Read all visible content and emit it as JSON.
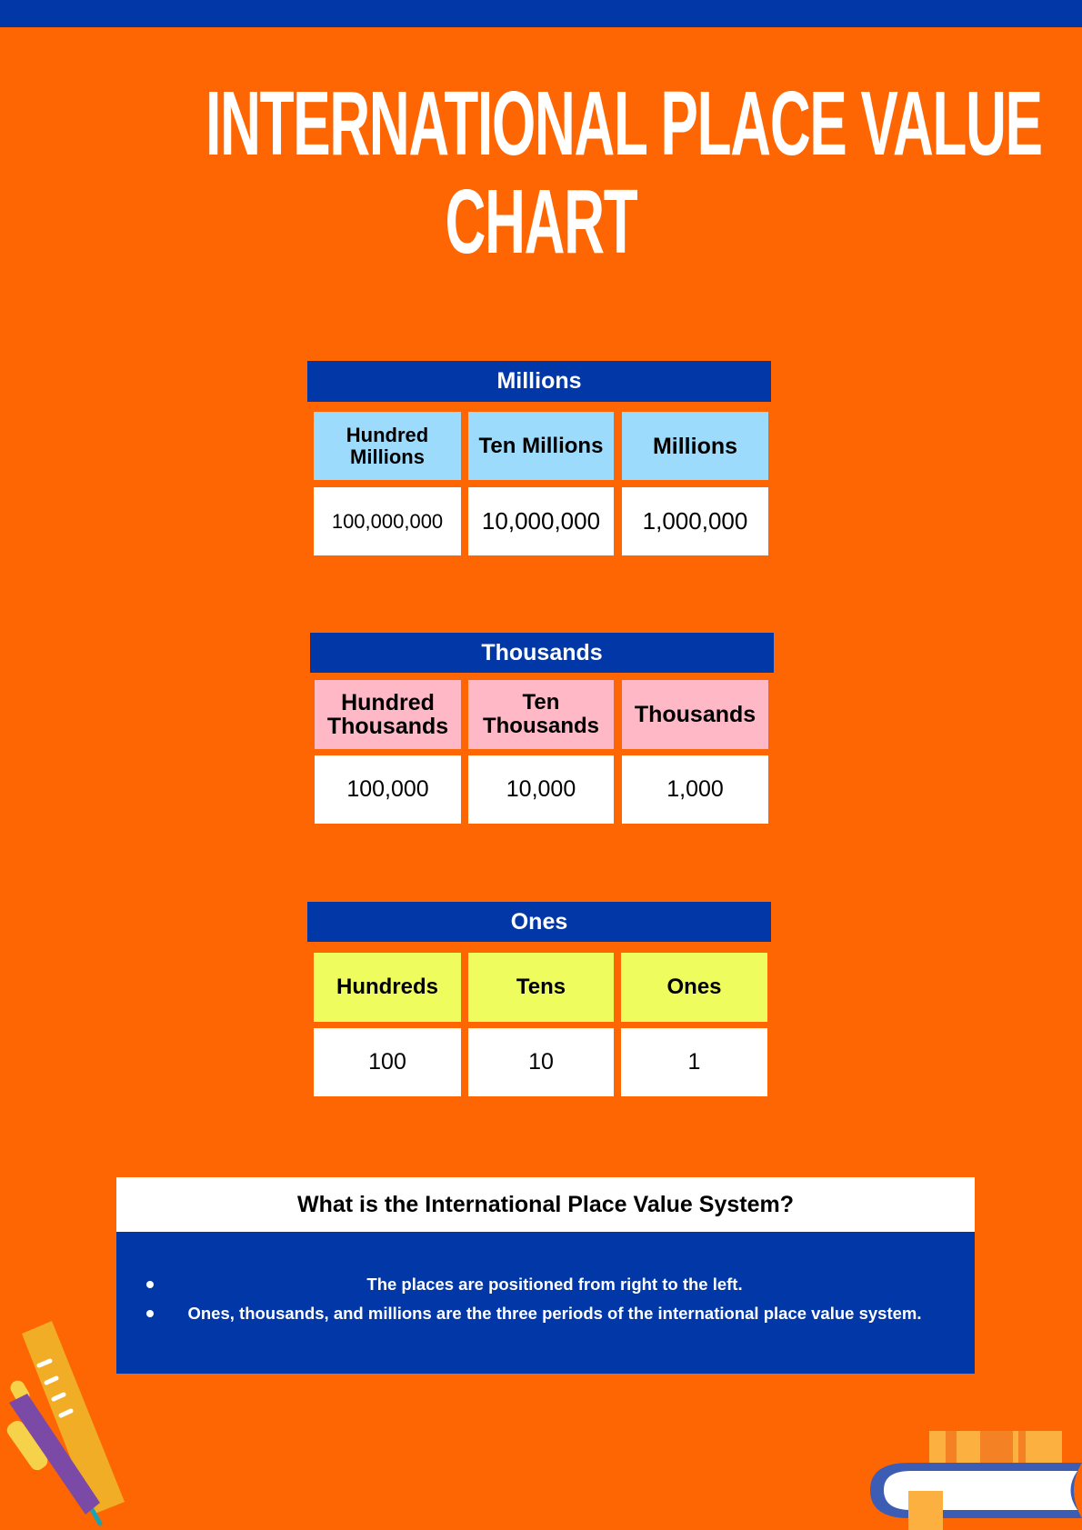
{
  "title_lines": [
    "INTERNATIONAL PLACE VALUE",
    "CHART"
  ],
  "colors": {
    "background": "#fd6602",
    "accent_blue": "#0237a8",
    "millions_header": "#9ddbfc",
    "thousands_header": "#feb8c6",
    "ones_header": "#eefc5e"
  },
  "periods": [
    {
      "name": "Millions",
      "columns": [
        {
          "label": "Hundred Millions",
          "value": "100,000,000"
        },
        {
          "label": "Ten Millions",
          "value": "10,000,000"
        },
        {
          "label": "Millions",
          "value": "1,000,000"
        }
      ]
    },
    {
      "name": "Thousands",
      "columns": [
        {
          "label": "Hundred Thousands",
          "value": "100,000"
        },
        {
          "label": "Ten Thousands",
          "value": "10,000"
        },
        {
          "label": "Thousands",
          "value": "1,000"
        }
      ]
    },
    {
      "name": "Ones",
      "columns": [
        {
          "label": "Hundreds",
          "value": "100"
        },
        {
          "label": "Tens",
          "value": "10"
        },
        {
          "label": "Ones",
          "value": "1"
        }
      ]
    }
  ],
  "info": {
    "title": "What is the International Place Value System?",
    "bullets": [
      "The places are positioned from right to the left.",
      "Ones, thousands, and millions are the three periods of the international place value system."
    ]
  },
  "decorations": {
    "bottom_left": "ruler-and-pen-icon",
    "bottom_right": "books-stack-icon"
  }
}
